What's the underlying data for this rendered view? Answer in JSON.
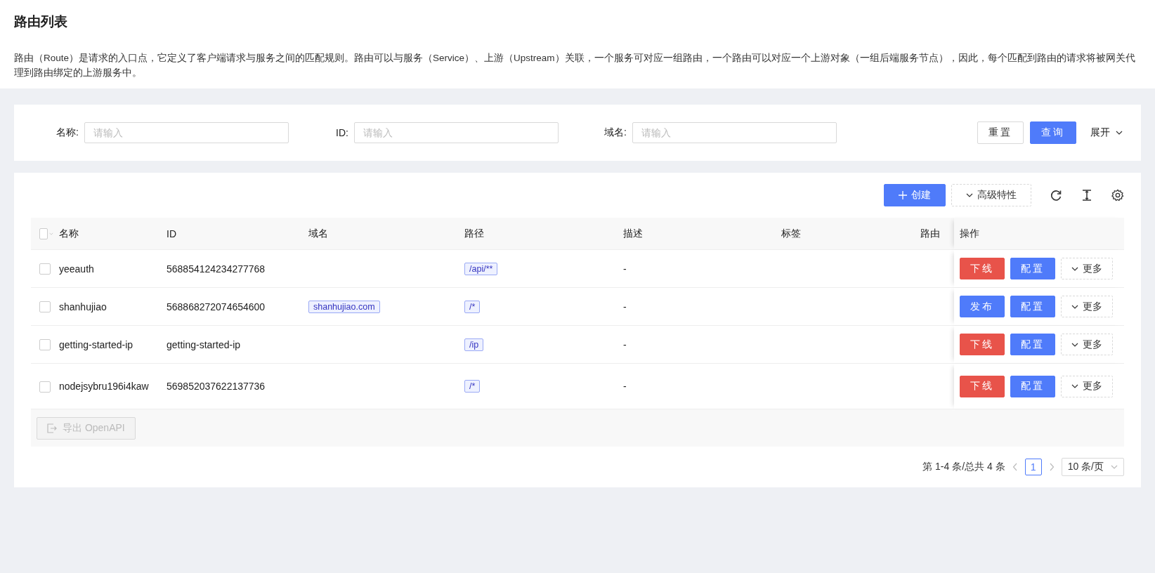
{
  "page": {
    "title": "路由列表",
    "description": "路由（Route）是请求的入口点，它定义了客户端请求与服务之间的匹配规则。路由可以与服务（Service）、上游（Upstream）关联，一个服务可对应一组路由，一个路由可以对应一个上游对象（一组后端服务节点），因此，每个匹配到路由的请求将被网关代理到路由绑定的上游服务中。"
  },
  "search": {
    "fields": [
      {
        "label": "名称:",
        "placeholder": "请输入"
      },
      {
        "label": "ID:",
        "placeholder": "请输入"
      },
      {
        "label": "域名:",
        "placeholder": "请输入"
      }
    ],
    "buttons": [
      {
        "label": "重置",
        "kind": "default"
      },
      {
        "label": "查询",
        "kind": "primary"
      }
    ],
    "expand": "展开"
  },
  "toolbar": {
    "create": "创建",
    "advanced": "高级特性"
  },
  "table": {
    "select_all": {
      "checked": false
    },
    "columns": [
      "名称",
      "ID",
      "域名",
      "路径",
      "描述",
      "标签",
      "路由",
      "操作"
    ],
    "rows": [
      {
        "selected": false,
        "name": "yeeauth",
        "id": "568854124234277768",
        "paths": [
          "/api/**"
        ],
        "description": "-",
        "actions": [
          {
            "label": "下线",
            "kind": "danger"
          },
          {
            "label": "配置",
            "kind": "primary"
          },
          {
            "label": "更多",
            "kind": "more"
          }
        ]
      },
      {
        "selected": false,
        "name": "shanhujiao",
        "id": "568868272074654600",
        "hosts": [
          "shanhujiao.com"
        ],
        "paths": [
          "/*"
        ],
        "description": "-",
        "actions": [
          {
            "label": "发布",
            "kind": "primary"
          },
          {
            "label": "配置",
            "kind": "primary"
          },
          {
            "label": "更多",
            "kind": "more"
          }
        ]
      },
      {
        "selected": false,
        "name": "getting-started-ip",
        "id": "getting-started-ip",
        "paths": [
          "/ip"
        ],
        "description": "-",
        "actions": [
          {
            "label": "下线",
            "kind": "danger"
          },
          {
            "label": "配置",
            "kind": "primary"
          },
          {
            "label": "更多",
            "kind": "more"
          }
        ]
      },
      {
        "selected": false,
        "name": "nodejsybru196i4kaw",
        "id": "569852037622137736",
        "paths": [
          "/*"
        ],
        "description": "-",
        "actions": [
          {
            "label": "下线",
            "kind": "danger"
          },
          {
            "label": "配置",
            "kind": "primary"
          },
          {
            "label": "更多",
            "kind": "more"
          }
        ]
      }
    ],
    "export": {
      "label": "导出 OpenAPI",
      "disabled": true
    }
  },
  "pagination": {
    "summary": "第 1-4 条/总共 4 条",
    "pages": [
      {
        "label": "1",
        "selected": true
      }
    ],
    "page_size": "10 条/页"
  }
}
